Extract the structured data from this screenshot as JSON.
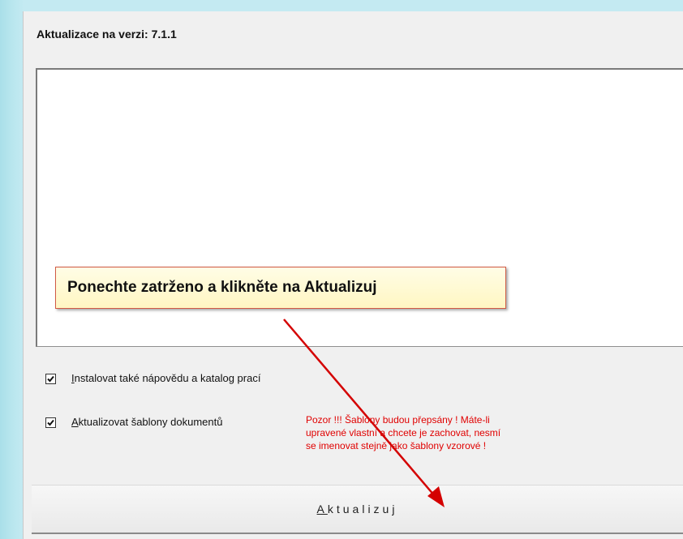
{
  "dialog": {
    "title": "Aktualizace na verzi: 7.1.1"
  },
  "callout": {
    "text": "Ponechte zatrženo a klikněte na Aktualizuj"
  },
  "options": [
    {
      "accel": "I",
      "rest": "nstalovat také nápovědu a katalog prací",
      "checked": true
    },
    {
      "accel": "A",
      "rest": "ktualizovat šablony dokumentů",
      "checked": true
    }
  ],
  "warning": {
    "lines": [
      "Pozor !!! Šablony budou přepsány ! Máte-li",
      "upravené vlastní a chcete je zachovat, nesmí",
      "se imenovat stejně jako šablony vzorové !"
    ]
  },
  "update_button": {
    "label": "Aktualizuj"
  },
  "colors": {
    "annotation_arrow": "#d40000",
    "warning_text": "#e00000",
    "callout_border": "#d15a44"
  }
}
